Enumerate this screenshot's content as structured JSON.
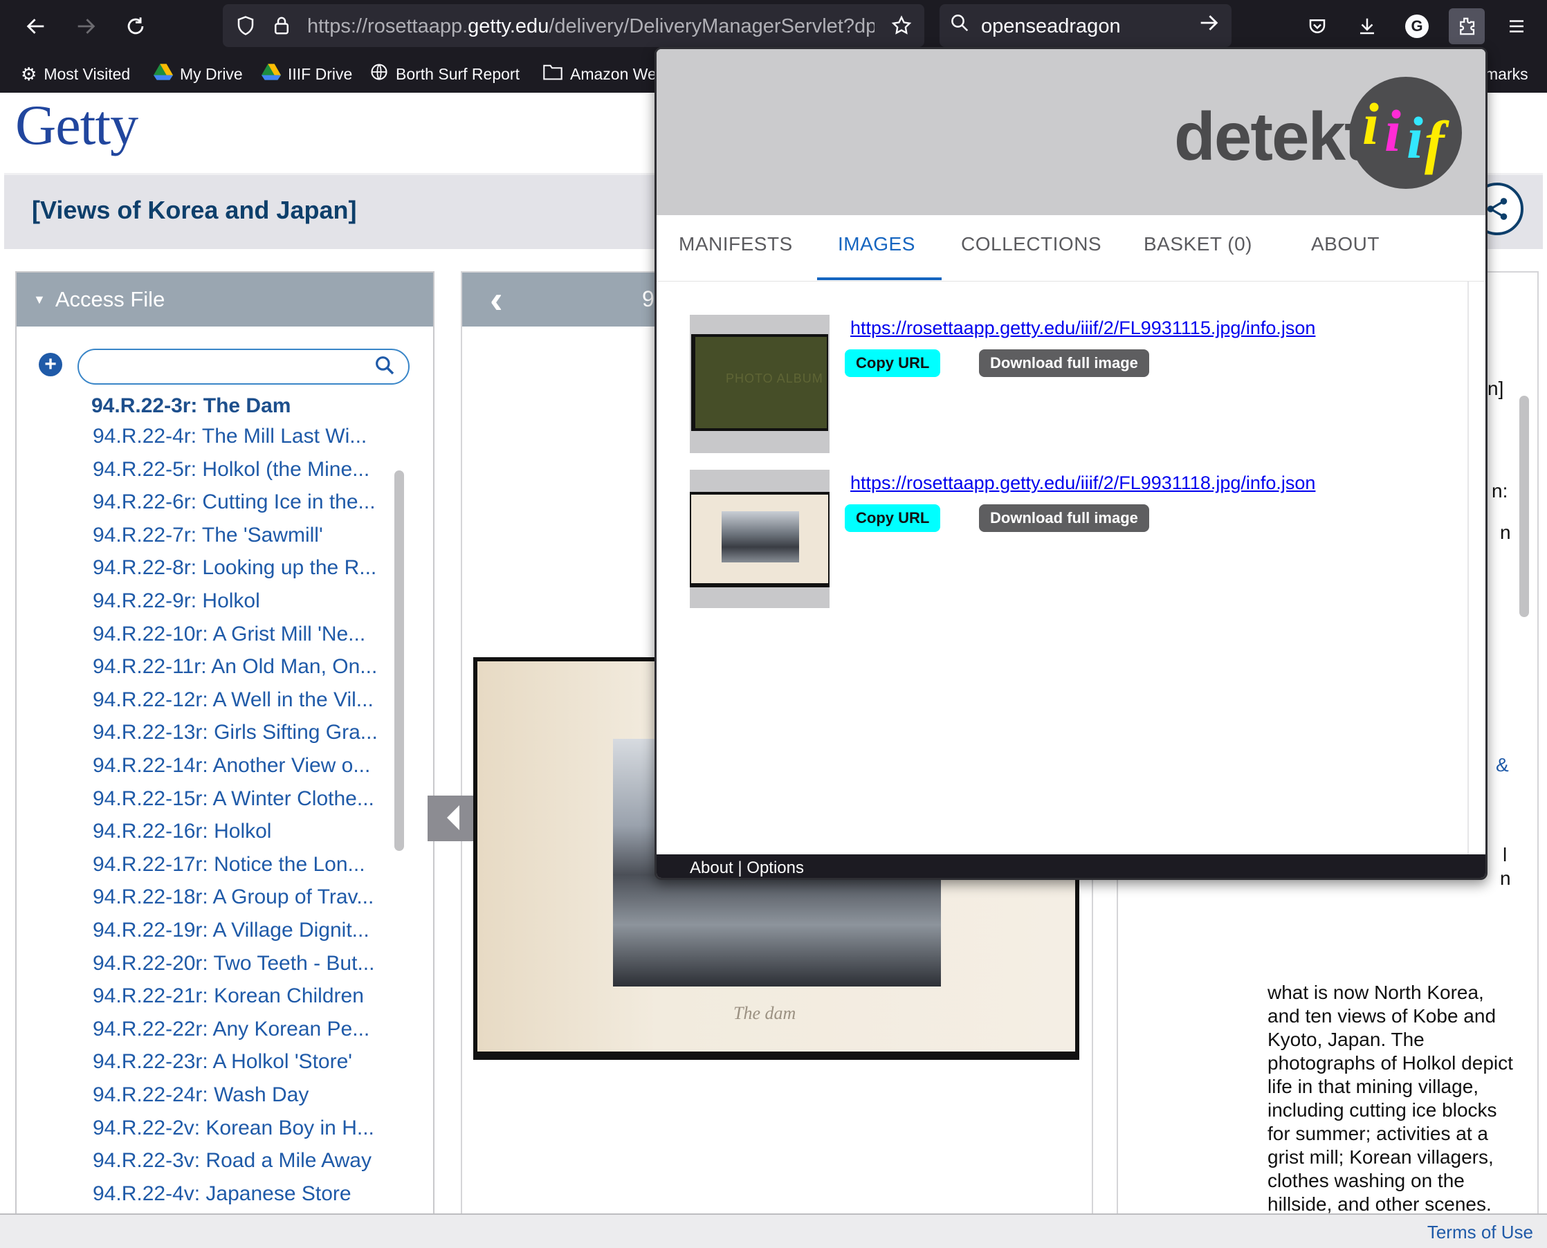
{
  "browser": {
    "url_prefix": "https://rosettaapp.",
    "url_domain": "getty.edu",
    "url_rest": "/delivery/DeliveryManagerServlet?dps",
    "search_text": "openseadragon",
    "bookmarks": [
      "Most Visited",
      "My Drive",
      "IIIF Drive",
      "Borth Surf Report",
      "Amazon We",
      "marks"
    ],
    "avatar_letter": "G"
  },
  "page": {
    "logo": "Getty",
    "title": "[Views of Korea and Japan]",
    "access_file_label": "Access File",
    "viewer_counter": "9",
    "list_current": "94.R.22-3r: The Dam",
    "list_items": [
      "94.R.22-4r: The Mill Last Wi...",
      "94.R.22-5r: Holkol (the Mine...",
      "94.R.22-6r: Cutting Ice in the...",
      "94.R.22-7r: The 'Sawmill'",
      "94.R.22-8r: Looking up the R...",
      "94.R.22-9r: Holkol",
      "94.R.22-10r: A Grist Mill 'Ne...",
      "94.R.22-11r: An Old Man, On...",
      "94.R.22-12r: A Well in the Vil...",
      "94.R.22-13r: Girls Sifting Gra...",
      "94.R.22-14r: Another View o...",
      "94.R.22-15r: A Winter Clothe...",
      "94.R.22-16r: Holkol",
      "94.R.22-17r: Notice the Lon...",
      "94.R.22-18r: A Group of Trav...",
      "94.R.22-19r: A Village Dignit...",
      "94.R.22-20r: Two Teeth - But...",
      "94.R.22-21r: Korean Children",
      "94.R.22-22r: Any Korean Pe...",
      "94.R.22-23r: A Holkol 'Store'",
      "94.R.22-24r: Wash Day",
      "94.R.22-2v: Korean Boy in H...",
      "94.R.22-3v: Road a Mile Away",
      "94.R.22-4v: Japanese Store"
    ],
    "book_caption": "The dam",
    "right_fragments": [
      "n]",
      "n:",
      "n",
      "&",
      "l",
      "n"
    ],
    "description": "what is now North Korea, and ten views of Kobe and Kyoto, Japan. The photographs of Holkol depict life in that mining village, including cutting ice blocks for summer; activities at a grist mill; Korean villagers, clothes washing on the hillside, and other scenes. Views in Pyongyang include the Tahlong (Tatong) River bridge. The photographs of",
    "terms": "Terms of Use"
  },
  "popup": {
    "brand_word": "detekt",
    "brand_badge": "iiif",
    "tabs": [
      "MANIFESTS",
      "IMAGES",
      "COLLECTIONS",
      "BASKET (0)",
      "ABOUT"
    ],
    "active_tab": "IMAGES",
    "results": [
      {
        "url": "https://rosettaapp.getty.edu/iiif/2/FL9931115.jpg/info.json",
        "copy_label": "Copy URL",
        "download_label": "Download full image",
        "thumb_text": "PHOTO ALBUM"
      },
      {
        "url": "https://rosettaapp.getty.edu/iiif/2/FL9931118.jpg/info.json",
        "copy_label": "Copy URL",
        "download_label": "Download full image"
      }
    ],
    "footer": "About | Options"
  },
  "colors": {
    "getty_blue": "#21469e",
    "link_blue": "#1f5aa8",
    "copy_cyan": "#00ffff",
    "tab_active": "#1565c0"
  }
}
